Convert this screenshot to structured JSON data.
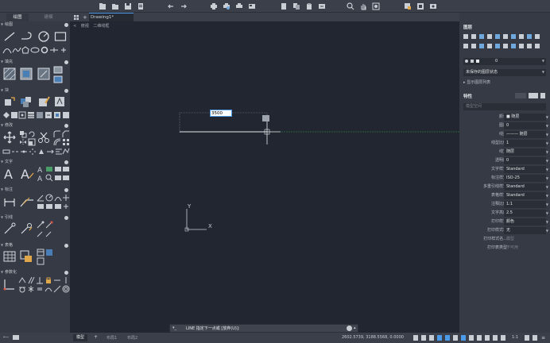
{
  "palette_tabs": {
    "draw": "绘图",
    "modify_tab": "建模"
  },
  "left_sections": [
    {
      "label": "绘图"
    },
    {
      "label": "填充"
    },
    {
      "label": "块"
    },
    {
      "label": "修改"
    },
    {
      "label": "文字"
    },
    {
      "label": "标注"
    },
    {
      "label": "引线"
    },
    {
      "label": "表格"
    },
    {
      "label": "参数化"
    }
  ],
  "document": {
    "tab_label": "Drawing1*",
    "new_tab": "+"
  },
  "breadcrumb": {
    "back": "<",
    "view": "俯视",
    "style": "二维线框"
  },
  "drawing": {
    "dim_input_value": "3500",
    "ucs_y": "Y",
    "ucs_x": "X"
  },
  "command": {
    "prompt": "LINE 指定下一点或 [放弃(U)]:"
  },
  "status": {
    "model_tab": "模型",
    "add_tab": "+",
    "layout1": "布局1",
    "layout2": "布局2",
    "coords": "2602.5739, 3188.5568, 0.0000",
    "scale": "1:1"
  },
  "layers_panel": {
    "title": "图层",
    "current_layer": "0",
    "layer_state": "未保存的图层状态",
    "show_list": "显示图层列表"
  },
  "properties": {
    "title": "特性",
    "sub": "模型空间",
    "rows": [
      {
        "label": "颜色",
        "value": "■ 随层",
        "box": true
      },
      {
        "label": "图层",
        "value": "0",
        "box": true
      },
      {
        "label": "线型",
        "value": "——— 随层",
        "box": true
      },
      {
        "label": "线型比例",
        "value": "1",
        "box": true
      },
      {
        "label": "线宽",
        "value": "随层",
        "box": true
      },
      {
        "label": "透明度",
        "value": "0",
        "box": true
      },
      {
        "label": "文字样式",
        "value": "Standard",
        "box": true
      },
      {
        "label": "标注样式",
        "value": "ISO-25",
        "box": true
      },
      {
        "label": "多重引线样式",
        "value": "Standard",
        "box": true
      },
      {
        "label": "表格样式",
        "value": "Standard",
        "box": true
      },
      {
        "label": "注释比例",
        "value": "1:1",
        "box": true
      },
      {
        "label": "文字高度",
        "value": "2.5",
        "box": true
      },
      {
        "label": "打印样式",
        "value": "颜色",
        "box": true
      },
      {
        "label": "打印样式表",
        "value": "无",
        "box": true
      },
      {
        "label": "打印样式名...",
        "value": "模型",
        "box": false
      },
      {
        "label": "打印表类型",
        "value": "不可用",
        "box": false
      }
    ]
  }
}
